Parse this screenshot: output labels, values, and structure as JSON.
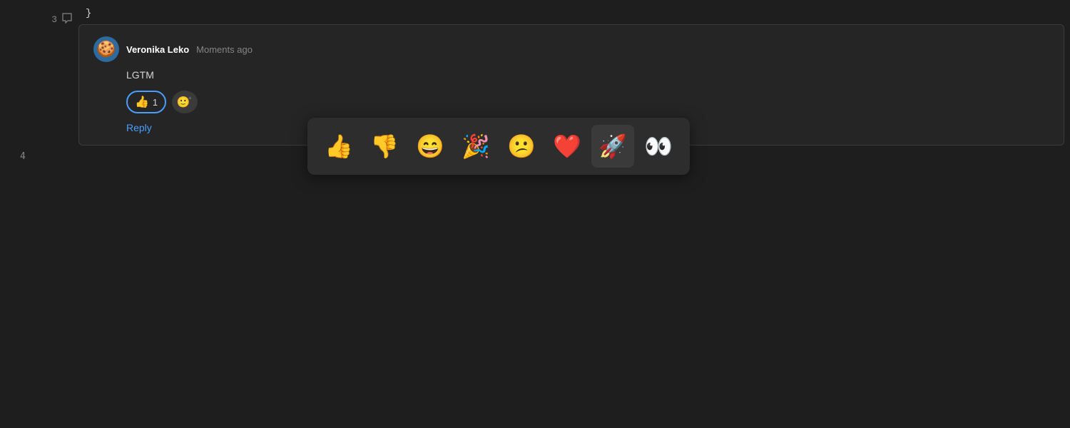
{
  "gutter": {
    "line3": "3",
    "line4": "4",
    "chat_icon": "💬"
  },
  "code": {
    "brace": "}"
  },
  "comment": {
    "author": "Veronika Leko",
    "time": "Moments ago",
    "body": "LGTM",
    "reaction_emoji": "👍",
    "reaction_count": "1",
    "reply_label": "Reply"
  },
  "emoji_picker": {
    "emojis": [
      {
        "id": "thumbs-up",
        "glyph": "👍",
        "label": "Thumbs up",
        "selected": false
      },
      {
        "id": "thumbs-down",
        "glyph": "👎",
        "label": "Thumbs down",
        "selected": false
      },
      {
        "id": "grinning-face",
        "glyph": "😄",
        "label": "Grinning face",
        "selected": false
      },
      {
        "id": "party-popper",
        "glyph": "🎉",
        "label": "Party popper",
        "selected": false
      },
      {
        "id": "confused-face",
        "glyph": "😕",
        "label": "Confused face",
        "selected": false
      },
      {
        "id": "heart",
        "glyph": "❤️",
        "label": "Heart",
        "selected": false
      },
      {
        "id": "rocket",
        "glyph": "🚀",
        "label": "Rocket",
        "selected": true
      },
      {
        "id": "eyes",
        "glyph": "👀",
        "label": "Eyes",
        "selected": false
      }
    ]
  }
}
